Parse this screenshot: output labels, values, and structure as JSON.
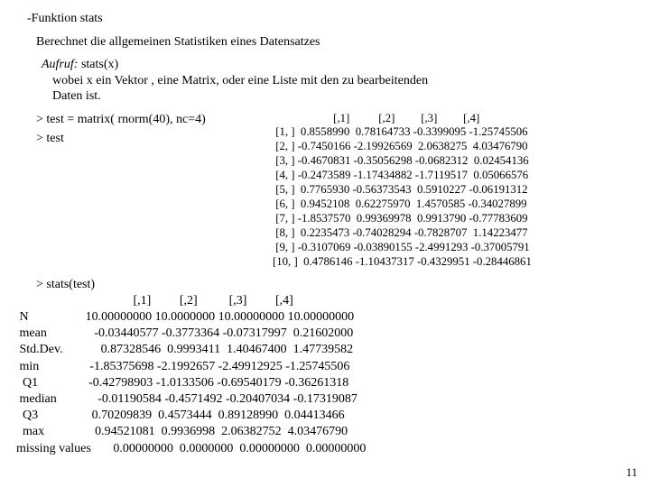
{
  "header": {
    "title": "-Funktion  stats",
    "desc": "Berechnet  die allgemeinen Statistiken eines Datensatzes",
    "aufruf_label": "Aufruf:",
    "aufruf_code": "stats(x)",
    "aufruf_desc1": "wobei x ein Vektor , eine Matrix, oder eine Liste mit den zu bearbeitenden",
    "aufruf_desc2": "Daten ist."
  },
  "prompt1": "> test =  matrix( rnorm(40), nc=4)",
  "prompt2": "> test",
  "matrix_text": "                     [,1]          [,2]         [,3]         [,4]\n [1, ]  0.8558990  0.78164733 -0.3399095 -1.25745506\n [2, ] -0.7450166 -2.19926569  2.0638275  4.03476790\n [3, ] -0.4670831 -0.35056298 -0.0682312  0.02454136\n [4, ] -0.2473589 -1.17434882 -1.7119517  0.05066576\n [5, ]  0.7765930 -0.56373543  0.5910227 -0.06191312\n [6, ]  0.9452108  0.62275970  1.4570585 -0.34027899\n [7, ] -1.8537570  0.99369978  0.9913790 -0.77783609\n [8, ]  0.2235473 -0.74028294 -0.7828707  1.14223477\n [9, ] -0.3107069 -0.03890155 -2.4991293 -0.37005791\n[10, ]  0.4786146 -1.10437317 -0.4329951 -0.28446861",
  "stats_prompt": "> stats(test)",
  "stats_text": "                                     [,1]         [,2]          [,3]         [,4]\n N                  10.00000000 10.0000000 10.00000000 10.00000000\n mean               -0.03440577 -0.3773364 -0.07317997  0.21602000\n Std.Dev.            0.87328546  0.9993411  1.40467400  1.47739582\n min                -1.85375698 -2.1992657 -2.49912925 -1.25745506\n  Q1                -0.42798903 -1.0133506 -0.69540179 -0.36261318\n median             -0.01190584 -0.4571492 -0.20407034 -0.17319087\n  Q3                 0.70209839  0.4573444  0.89128990  0.04413466\n  max                0.94521081  0.9936998  2.06382752  4.03476790\nmissing values       0.00000000  0.0000000  0.00000000  0.00000000",
  "page_number": "11",
  "chart_data": {
    "type": "table",
    "tables": [
      {
        "name": "test",
        "columns": [
          "[,1]",
          "[,2]",
          "[,3]",
          "[,4]"
        ],
        "rows": [
          [
            0.855899,
            0.78164733,
            -0.3399095,
            -1.25745506
          ],
          [
            -0.7450166,
            -2.19926569,
            2.0638275,
            4.0347679
          ],
          [
            -0.4670831,
            -0.35056298,
            -0.0682312,
            0.02454136
          ],
          [
            -0.2473589,
            -1.17434882,
            -1.7119517,
            0.05066576
          ],
          [
            0.776593,
            -0.56373543,
            0.5910227,
            -0.06191312
          ],
          [
            0.9452108,
            0.6227597,
            1.4570585,
            -0.34027899
          ],
          [
            -1.853757,
            0.99369978,
            0.991379,
            -0.77783609
          ],
          [
            0.2235473,
            -0.74028294,
            -0.7828707,
            1.14223477
          ],
          [
            -0.3107069,
            -0.03890155,
            -2.4991293,
            -0.37005791
          ],
          [
            0.4786146,
            -1.10437317,
            -0.4329951,
            -0.28446861
          ]
        ]
      },
      {
        "name": "stats(test)",
        "columns": [
          "[,1]",
          "[,2]",
          "[,3]",
          "[,4]"
        ],
        "row_labels": [
          "N",
          "mean",
          "Std.Dev.",
          "min",
          "Q1",
          "median",
          "Q3",
          "max",
          "missing values"
        ],
        "rows": [
          [
            10.0,
            10.0,
            10.0,
            10.0
          ],
          [
            -0.03440577,
            -0.3773364,
            -0.07317997,
            0.21602
          ],
          [
            0.87328546,
            0.9993411,
            1.404674,
            1.47739582
          ],
          [
            -1.85375698,
            -2.1992657,
            -2.49912925,
            -1.25745506
          ],
          [
            -0.42798903,
            -1.0133506,
            -0.69540179,
            -0.36261318
          ],
          [
            -0.01190584,
            -0.4571492,
            -0.20407034,
            -0.17319087
          ],
          [
            0.70209839,
            0.4573444,
            0.8912899,
            0.04413466
          ],
          [
            0.94521081,
            0.9936998,
            2.06382752,
            4.0347679
          ],
          [
            0.0,
            0.0,
            0.0,
            0.0
          ]
        ]
      }
    ]
  }
}
